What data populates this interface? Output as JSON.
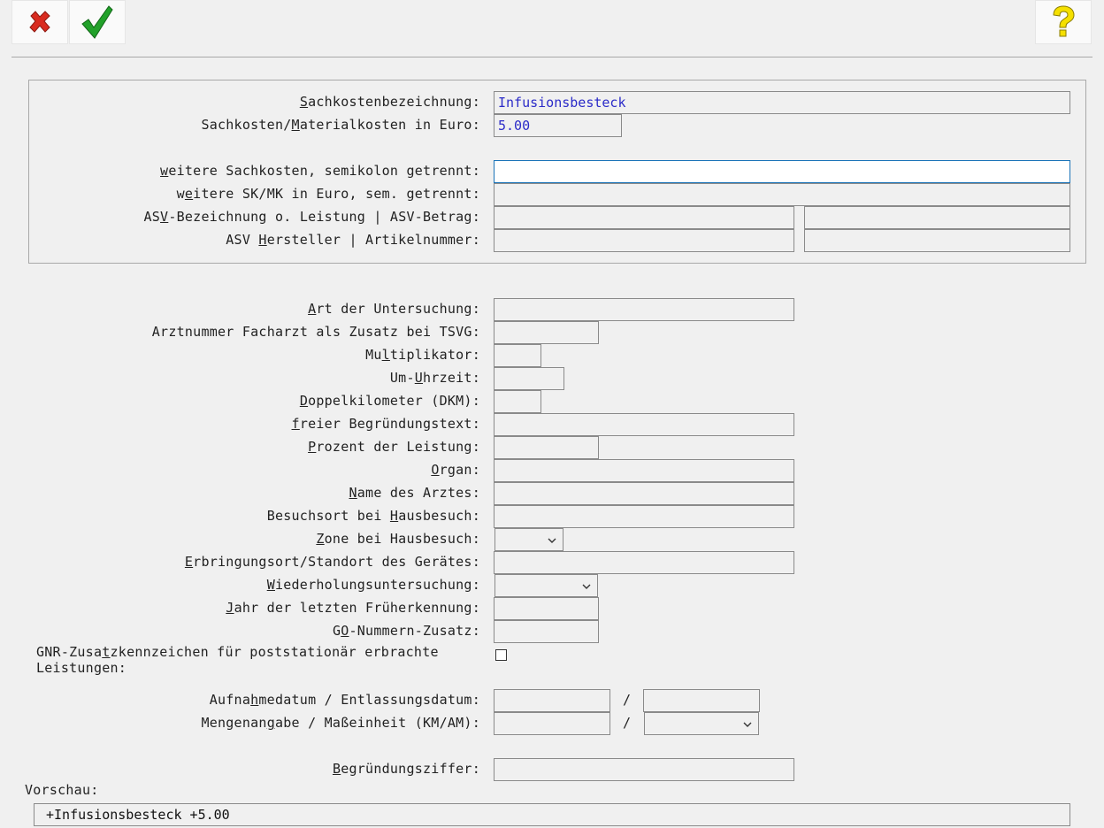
{
  "toolbar": {
    "cancel_icon": "red-x-icon",
    "confirm_icon": "green-check-icon",
    "help_icon": "yellow-question-icon",
    "colors": {
      "cancel": "#d92b1f",
      "confirm": "#22a12a",
      "help": "#f5e000"
    }
  },
  "group": {
    "sachkosten_label": {
      "u": "S",
      "rest": "achkostenbezeichnung:"
    },
    "sachkosten_value": "Infusionsbesteck",
    "material_label": {
      "pre": "Sachkosten/",
      "u": "M",
      "rest": "aterialkosten in Euro:"
    },
    "material_value": "5.00",
    "weitere_label": {
      "u": "w",
      "rest": "eitere Sachkosten, semikolon getrennt:"
    },
    "weitere_sk_label": {
      "pre": "w",
      "u": "e",
      "rest": "itere SK/MK in Euro, sem. getrennt:"
    },
    "asv_label": {
      "pre": "AS",
      "u": "V",
      "rest": "-Bezeichnung o. Leistung | ASV-Betrag:"
    },
    "asv_hersteller_label": {
      "pre": "ASV ",
      "u": "H",
      "rest": "ersteller | Artikelnummer:"
    }
  },
  "fields": {
    "art": {
      "u": "A",
      "rest": "rt der Untersuchung:"
    },
    "arztnummer": {
      "pre": "Arztnummer Facharzt als Zusatz bei TSVG:"
    },
    "multiplikator": {
      "pre": "Mu",
      "u": "l",
      "rest": "tiplikator:"
    },
    "uhrzeit": {
      "pre": "Um-",
      "u": "U",
      "rest": "hrzeit:"
    },
    "doppel": {
      "u": "D",
      "rest": "oppelkilometer (DKM):"
    },
    "freier": {
      "u": "f",
      "rest": "reier Begründungstext:"
    },
    "prozent": {
      "u": "P",
      "rest": "rozent der Leistung:"
    },
    "organ": {
      "u": "O",
      "rest": "rgan:"
    },
    "name": {
      "u": "N",
      "rest": "ame des Arztes:"
    },
    "besuchsort": {
      "pre": "Besuchsort bei ",
      "u": "H",
      "rest": "ausbesuch:"
    },
    "zone": {
      "u": "Z",
      "rest": "one bei Hausbesuch:"
    },
    "erbringungsort": {
      "u": "E",
      "rest": "rbringungsort/Standort des Gerätes:"
    },
    "wiederholung": {
      "u": "W",
      "rest": "iederholungsuntersuchung:"
    },
    "jahr": {
      "u": "J",
      "rest": "ahr der letzten Früherkennung:"
    },
    "go": {
      "pre": "G",
      "u": "O",
      "rest": "-Nummern-Zusatz:"
    },
    "gnr": {
      "pre": "GNR-Zusa",
      "u": "t",
      "rest": "zkennzeichen für poststationär erbrachte Leistungen:"
    },
    "aufnahme": {
      "pre": "Aufna",
      "u": "h",
      "rest": "medatum / Entlassungsdatum:"
    },
    "menge": {
      "pre": "Mengenan",
      "u": "g",
      "rest": "abe / Maßeinheit (KM/AM):"
    },
    "begruendung": {
      "u": "B",
      "rest": "egründungsziffer:"
    }
  },
  "slash": "/",
  "preview": {
    "label": "Vorschau:",
    "value": "+Infusionsbesteck +5.00"
  }
}
